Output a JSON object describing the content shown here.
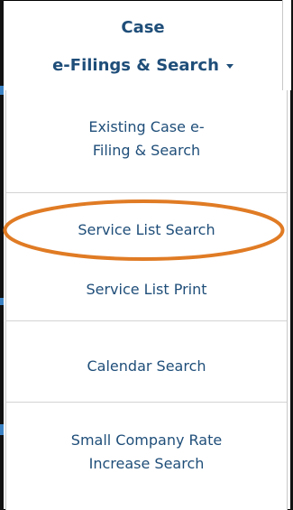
{
  "menu": {
    "title_line1": "Case",
    "title_line2": "e-Filings & Search",
    "items": [
      {
        "label_line1": "Existing Case e-",
        "label_line2": "Filing & Search"
      },
      {
        "label": "Service List Search"
      },
      {
        "label": "Service List Print"
      },
      {
        "label": "Calendar Search"
      },
      {
        "label_line1": "Small Company Rate",
        "label_line2": "Increase Search"
      }
    ]
  },
  "annotation": {
    "highlight_color": "#e07b24",
    "highlighted_item": "Service List Search"
  }
}
